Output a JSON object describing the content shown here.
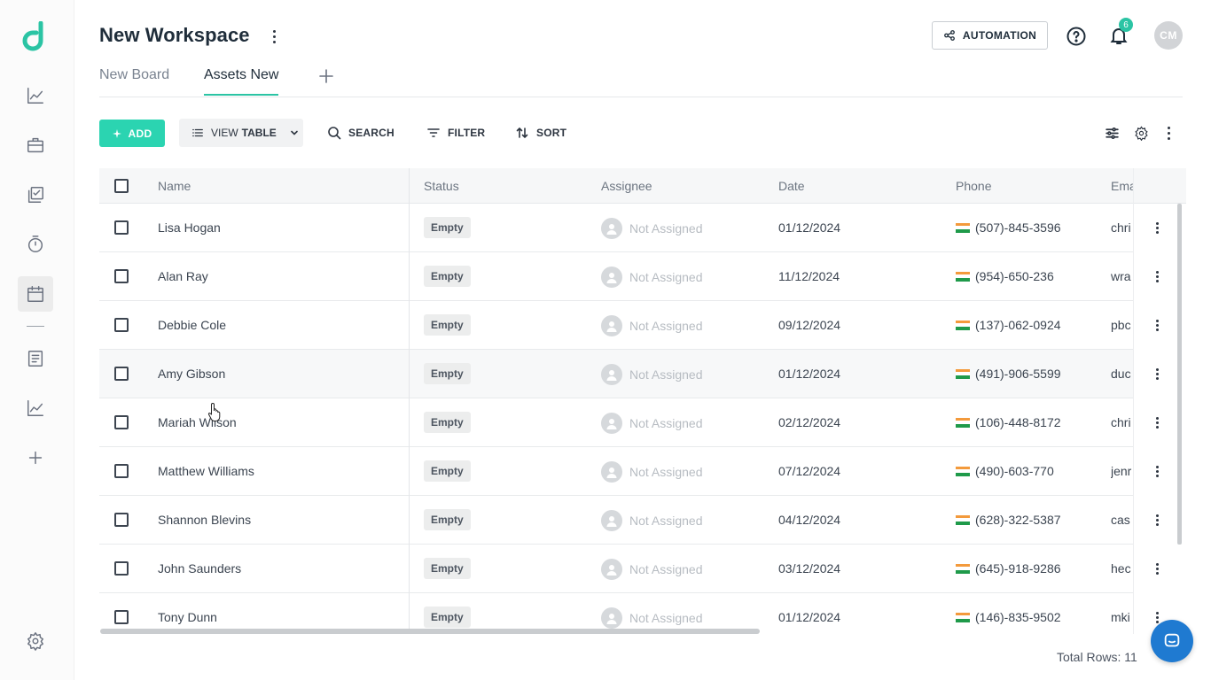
{
  "workspace": {
    "title": "New Workspace"
  },
  "header": {
    "automation_label": "AUTOMATION",
    "notification_count": "6",
    "avatar_initials": "CM"
  },
  "tabs": [
    {
      "label": "New Board"
    },
    {
      "label": "Assets New"
    }
  ],
  "toolbar": {
    "add_label": "ADD",
    "view_prefix": "VIEW",
    "view_value": "TABLE",
    "search_label": "SEARCH",
    "filter_label": "FILTER",
    "sort_label": "SORT"
  },
  "table": {
    "columns": [
      "Name",
      "Status",
      "Assignee",
      "Date",
      "Phone",
      "Ema"
    ],
    "rows": [
      {
        "name": "Lisa Hogan",
        "status": "Empty",
        "assignee": "Not Assigned",
        "date": "01/12/2024",
        "phone": "(507)-845-3596",
        "email": "chri"
      },
      {
        "name": "Alan Ray",
        "status": "Empty",
        "assignee": "Not Assigned",
        "date": "11/12/2024",
        "phone": "(954)-650-236",
        "email": "wra"
      },
      {
        "name": "Debbie Cole",
        "status": "Empty",
        "assignee": "Not Assigned",
        "date": "09/12/2024",
        "phone": "(137)-062-0924",
        "email": "pbc"
      },
      {
        "name": "Amy Gibson",
        "status": "Empty",
        "assignee": "Not Assigned",
        "date": "01/12/2024",
        "phone": "(491)-906-5599",
        "email": "duc"
      },
      {
        "name": "Mariah Wilson",
        "status": "Empty",
        "assignee": "Not Assigned",
        "date": "02/12/2024",
        "phone": "(106)-448-8172",
        "email": "chri"
      },
      {
        "name": "Matthew Williams",
        "status": "Empty",
        "assignee": "Not Assigned",
        "date": "07/12/2024",
        "phone": "(490)-603-770",
        "email": "jenr"
      },
      {
        "name": "Shannon Blevins",
        "status": "Empty",
        "assignee": "Not Assigned",
        "date": "04/12/2024",
        "phone": "(628)-322-5387",
        "email": "cas"
      },
      {
        "name": "John Saunders",
        "status": "Empty",
        "assignee": "Not Assigned",
        "date": "03/12/2024",
        "phone": "(645)-918-9286",
        "email": "hec"
      },
      {
        "name": "Tony Dunn",
        "status": "Empty",
        "assignee": "Not Assigned",
        "date": "01/12/2024",
        "phone": "(146)-835-9502",
        "email": "mki"
      }
    ],
    "total_rows_label": "Total Rows: 11"
  },
  "colors": {
    "accent": "#2bd4b1",
    "chat": "#1f7ad1"
  }
}
